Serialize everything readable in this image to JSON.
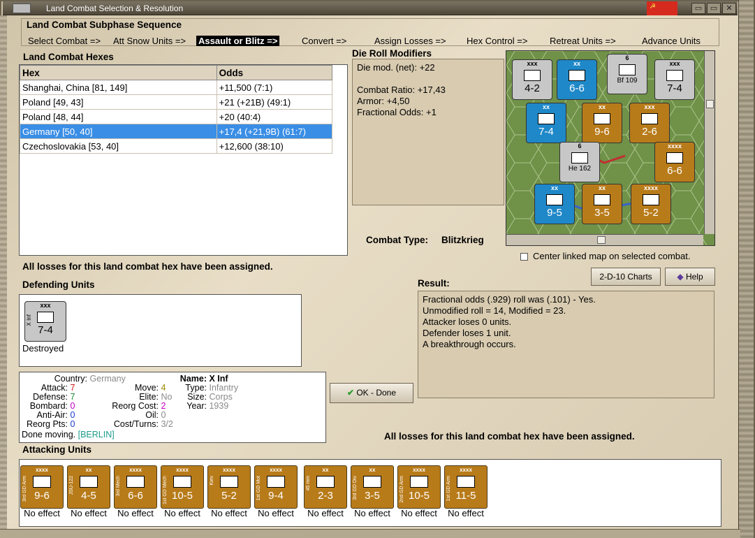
{
  "window": {
    "title": "Land Combat Selection & Resolution"
  },
  "sequence": {
    "heading": "Land Combat Subphase Sequence",
    "steps": [
      {
        "label": "Select Combat =>"
      },
      {
        "label": "Att Snow Units =>"
      },
      {
        "label": "Assault or Blitz =>"
      },
      {
        "label": "Convert =>"
      },
      {
        "label": "Assign Losses =>"
      },
      {
        "label": "Hex Control =>"
      },
      {
        "label": "Retreat Units =>"
      },
      {
        "label": "Advance Units"
      }
    ],
    "active_index": 2
  },
  "hexes": {
    "heading": "Land Combat Hexes",
    "columns": [
      "Hex",
      "Odds"
    ],
    "rows": [
      {
        "hex": "Shanghai, China [81, 149]",
        "odds": "+11,500 (7:1)"
      },
      {
        "hex": "Poland [49, 43]",
        "odds": "+21 (+21B) (49:1)"
      },
      {
        "hex": "Poland [48, 44]",
        "odds": "+20 (40:4)"
      },
      {
        "hex": "Germany [50, 40]",
        "odds": "+17,4 (+21,9B) (61:7)"
      },
      {
        "hex": "Czechoslovakia [53, 40]",
        "odds": "+12,600 (38:10)"
      }
    ],
    "selected_index": 3
  },
  "modifiers": {
    "heading": "Die Roll Modifiers",
    "lines": [
      "Die mod. (net): +22",
      "",
      "Combat Ratio: +17,43",
      "Armor: +4,50",
      "Fractional Odds: +1"
    ]
  },
  "combat_type": {
    "label": "Combat Type:",
    "value": "Blitzkrieg"
  },
  "center_map": {
    "label": "Center linked map on selected combat.",
    "checked": false
  },
  "losses_msg_1": "All losses for this land combat hex have been assigned.",
  "losses_msg_2": "All losses for this land combat hex have been assigned.",
  "buttons": {
    "charts": "2-D-10 Charts",
    "help": "Help",
    "ok": "OK - Done"
  },
  "defending": {
    "heading": "Defending Units",
    "units": [
      {
        "size": "xxx",
        "side": "X Inf",
        "value": "7-4",
        "status": "Destroyed"
      }
    ]
  },
  "result": {
    "heading": "Result:",
    "lines": [
      "Fractional odds (.929) roll was (.101)  - Yes.",
      "Unmodified roll = 14, Modified = 23.",
      "Attacker loses 0 units.",
      "Defender loses 1 unit.",
      "A breakthrough occurs."
    ]
  },
  "unit_info": {
    "country_label": "Country:",
    "country": "Germany",
    "attack_label": "Attack:",
    "attack": "7",
    "defense_label": "Defense:",
    "defense": "7",
    "bombard_label": "Bombard:",
    "bombard": "0",
    "antiair_label": "Anti-Air:",
    "antiair": "0",
    "reorg_label": "Reorg Pts:",
    "reorg": "0",
    "move_label": "Move:",
    "move": "4",
    "elite_label": "Elite:",
    "elite": "No",
    "reorgcost_label": "Reorg Cost:",
    "reorgcost": "2",
    "oil_label": "Oil:",
    "oil": "0",
    "costturns_label": "Cost/Turns:",
    "costturns": "3/2",
    "name_label": "Name:",
    "name": "X Inf",
    "type_label": "Type:",
    "type": "Infantry",
    "size_label": "Size:",
    "size": "Corps",
    "year_label": "Year:",
    "year": "1939",
    "done_label": "Done moving.",
    "done_place": "[BERLIN]"
  },
  "attacking": {
    "heading": "Attacking Units",
    "units": [
      {
        "size": "xxxx",
        "side": "3rd GD Arm",
        "value": "9-6",
        "effect": "No effect"
      },
      {
        "size": "xx",
        "side": "JSU-122",
        "value": "4-5",
        "effect": "No effect"
      },
      {
        "size": "xxxx",
        "side": "3rd Mech",
        "value": "6-6",
        "effect": "No effect"
      },
      {
        "size": "xxxx",
        "side": "1st GD Mech",
        "value": "10-5",
        "effect": "No effect"
      },
      {
        "size": "xxxx",
        "side": "Kiev",
        "value": "5-2",
        "effect": "No effect"
      },
      {
        "size": "xxxx",
        "side": "1st GD Mot",
        "value": "9-4",
        "effect": "No effect"
      },
      {
        "size": "xx",
        "side": "45 mm",
        "value": "2-3",
        "effect": "No effect"
      },
      {
        "size": "xx",
        "side": "3rd GD Div",
        "value": "3-5",
        "effect": "No effect"
      },
      {
        "size": "xxxx",
        "side": "2nd GD Arm",
        "value": "10-5",
        "effect": "No effect"
      },
      {
        "size": "xxxx",
        "side": "1st GD Arm",
        "value": "11-5",
        "effect": "No effect"
      }
    ]
  },
  "map_counters": [
    {
      "label": "4-2",
      "top": "xxx"
    },
    {
      "label": "6-6",
      "top": "xx"
    },
    {
      "label": "Bf 109",
      "top": "6"
    },
    {
      "label": "7-4",
      "top": "xxx"
    },
    {
      "label": "7-4",
      "top": "xx"
    },
    {
      "label": "9-6",
      "top": "xx"
    },
    {
      "label": "2-6",
      "top": "xxx"
    },
    {
      "label": "He 162",
      "top": "6"
    },
    {
      "label": "6-6",
      "top": "xxxx"
    },
    {
      "label": "9-5",
      "top": "xx"
    },
    {
      "label": "3-5",
      "top": "xx"
    },
    {
      "label": "5-2",
      "top": "xxxx"
    }
  ],
  "colors": {
    "accent_selected": "#3a8ee6",
    "unit_gold": "#b87b1a",
    "unit_blue": "#1f88c8"
  }
}
